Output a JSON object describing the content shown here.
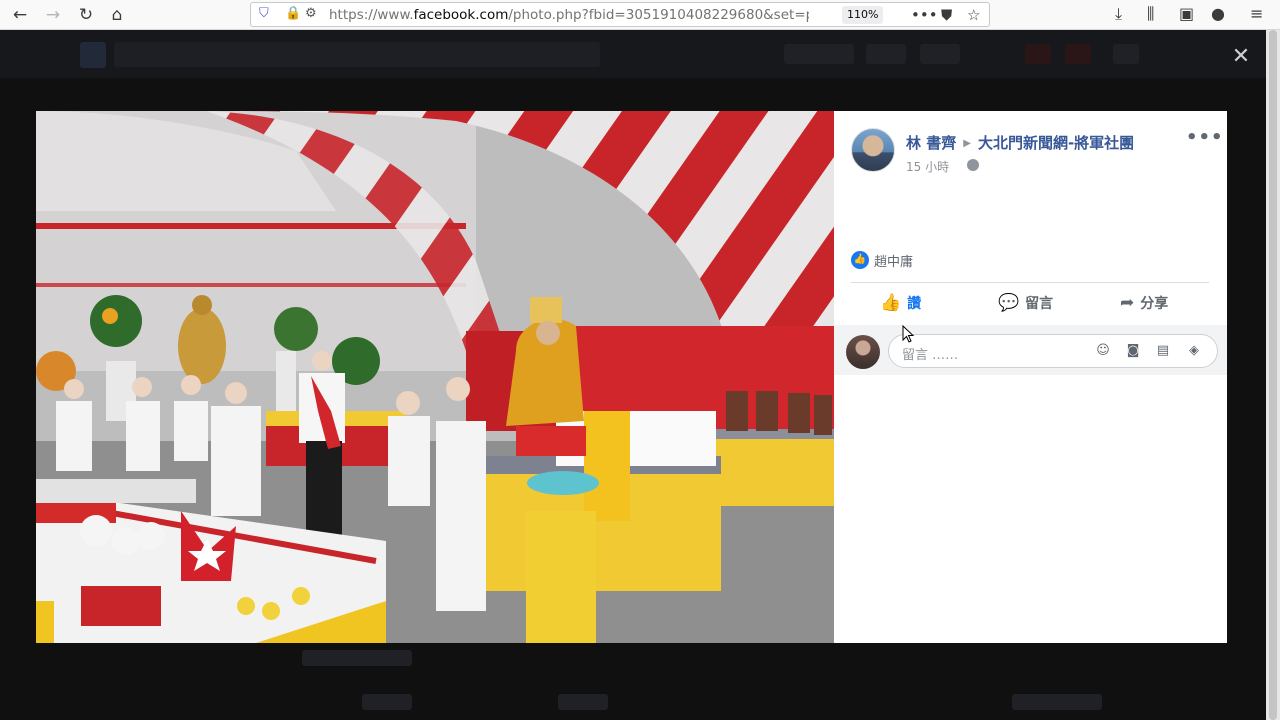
{
  "browser": {
    "back_icon": "arrow-left-icon",
    "forward_icon": "arrow-right-icon",
    "reload_icon": "reload-icon",
    "home_icon": "home-icon",
    "url_prefix": "https://www.",
    "url_host": "facebook.com",
    "url_rest": "/photo.php?fbid=305191040822968​0&set=p",
    "zoom": "110%",
    "toolbar_icons": [
      "more-icon",
      "pocket-icon",
      "bookmark-star-icon",
      "download-icon",
      "library-icon",
      "sidebar-icon",
      "account-icon",
      "menu-icon"
    ]
  },
  "viewer": {
    "close_label": "✕"
  },
  "post": {
    "author": "林 書齊",
    "group": "大北門新聞網-將軍社團",
    "time": "15 小時",
    "more_label": "•••",
    "liker": "趙中庸",
    "actions": {
      "like": "讚",
      "comment": "留言",
      "share": "分享"
    },
    "comment_placeholder": "留言 ……"
  },
  "colors": {
    "fb_blue": "#385898",
    "like_blue": "#1877f2",
    "tent_red": "#c8252b",
    "tablecloth_yellow": "#f1c933"
  }
}
